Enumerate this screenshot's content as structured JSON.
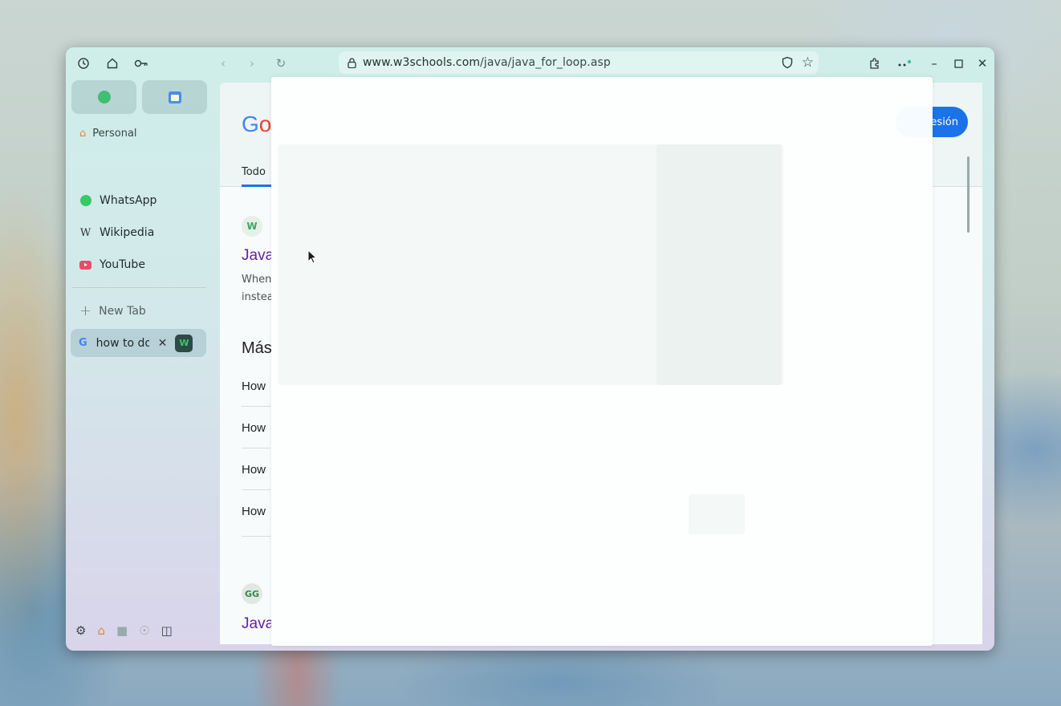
{
  "browser": {
    "url_host": "www.w3schools.com",
    "url_path": "/java/java_for_loop.asp",
    "icons": [
      "history-icon",
      "home-icon",
      "key-icon",
      "back-icon",
      "forward-icon",
      "reload-icon",
      "lock-icon",
      "shield-icon",
      "star-icon",
      "extensions-icon",
      "more-icon",
      "minimize-icon",
      "maximize-icon",
      "close-icon"
    ]
  },
  "sidebar": {
    "pinned": [
      {
        "name": "Spotify"
      },
      {
        "name": "Calendar"
      }
    ],
    "workspace": "Personal",
    "items": [
      {
        "label": "WhatsApp"
      },
      {
        "label": "Wikipedia"
      },
      {
        "label": "YouTube"
      }
    ],
    "new_tab_label": "New Tab",
    "active_tab": {
      "label": "how to do"
    }
  },
  "page": {
    "tab_todo": "Todo",
    "signin_label": "esión",
    "result1_title": "Java",
    "result1_snippet_line1": "When",
    "result1_snippet_line2": "instea",
    "more_heading": "Más",
    "how_items": [
      "How",
      "How",
      "How",
      "How"
    ],
    "result2_title": "Java"
  },
  "colors": {
    "accent": "#1a73e8",
    "visited_link": "#681da8",
    "sidebar_top": "#cfeee9",
    "sidebar_bottom": "#d9d4ea"
  }
}
